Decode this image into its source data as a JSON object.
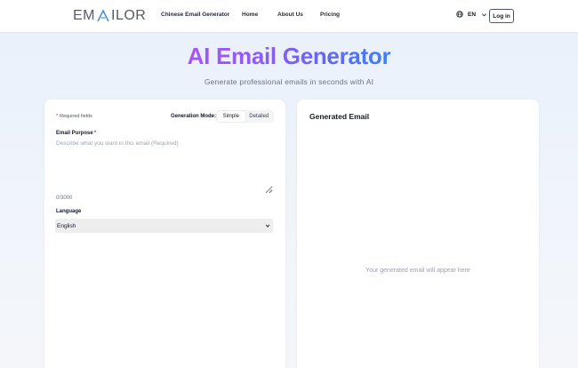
{
  "header": {
    "logo_left": "EM",
    "logo_right": "ILOR",
    "logo_icon": "a-logo-mark",
    "nav": [
      "Chinese Email Generator",
      "Home",
      "About Us",
      "Pricing"
    ],
    "language": "EN",
    "login_label": "Log in"
  },
  "hero": {
    "title": "AI Email Generator",
    "subtitle": "Generate professional emails in seconds with AI"
  },
  "form": {
    "required_note": "Required fields",
    "mode_label": "Generation Mode:",
    "modes": [
      "Simple",
      "Detailed"
    ],
    "active_mode": "Simple",
    "purpose_label": "Email Purpose",
    "purpose_placeholder": "Describe what you want in this email (Required)",
    "purpose_value": "",
    "counter": "0/3000",
    "language_label": "Language",
    "language_value": "English"
  },
  "output": {
    "title": "Generated Email",
    "placeholder": "Your generated email will appear here"
  },
  "colors": {
    "gradient_start": "#a855f7",
    "gradient_end": "#3b82f6",
    "required_star": "#dc2626"
  }
}
